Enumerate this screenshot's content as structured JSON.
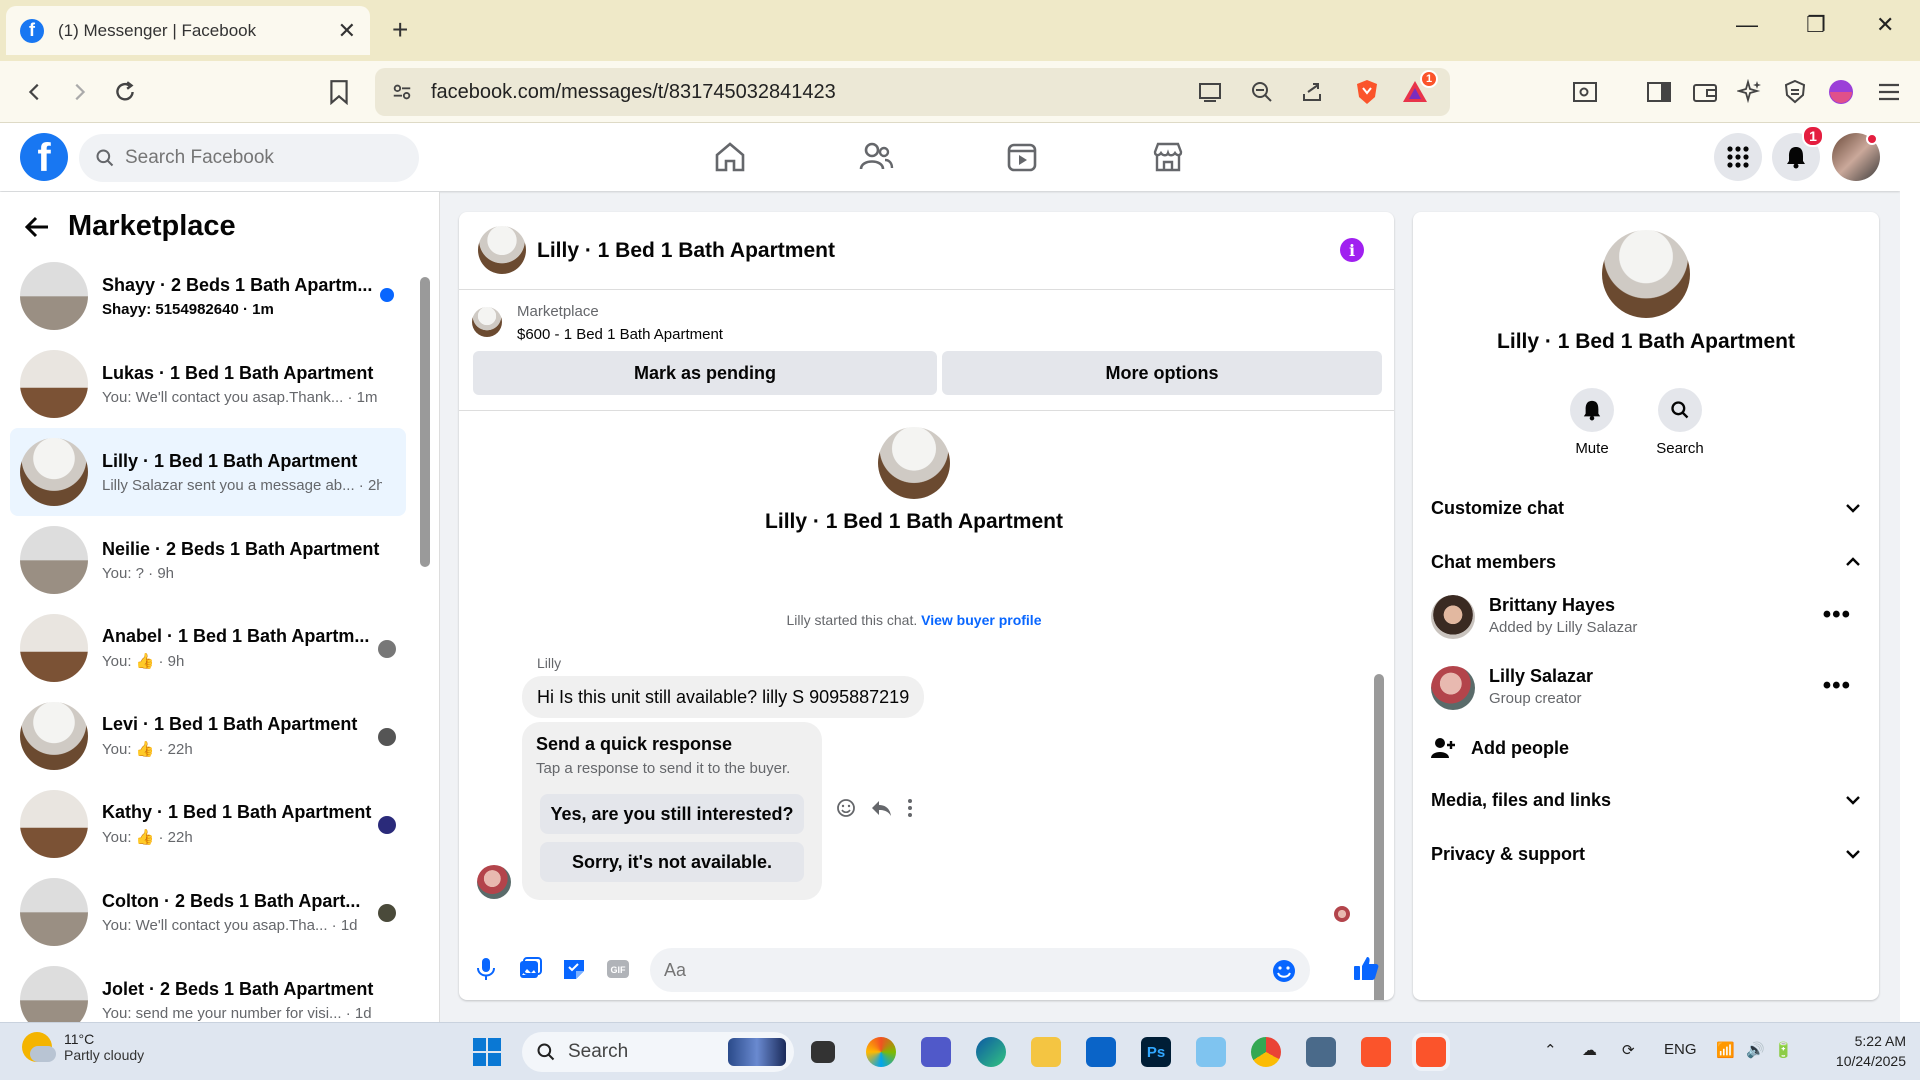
{
  "browser": {
    "tab_title": "(1) Messenger | Facebook",
    "url": "facebook.com/messages/t/831745032841423",
    "extension_badge": "1"
  },
  "fb_header": {
    "search_placeholder": "Search Facebook",
    "notification_count": "1"
  },
  "left_panel": {
    "title": "Marketplace",
    "conversations": [
      {
        "name": "Shayy · 2 Beds 1 Bath Apartm...",
        "snippet": "Shayy: 5154982640 · 1m",
        "unread": true
      },
      {
        "name": "Lukas · 1 Bed 1 Bath Apartment",
        "snippet": "You: We'll contact you asap.Thank... · 1m"
      },
      {
        "name": "Lilly · 1 Bed 1 Bath Apartment",
        "snippet": "Lilly Salazar sent you a message ab... · 2h",
        "active": true
      },
      {
        "name": "Neilie · 2 Beds 1 Bath Apartment",
        "snippet": "You: ? · 9h"
      },
      {
        "name": "Anabel · 1 Bed 1 Bath Apartm...",
        "snippet": "You: 👍 · 9h"
      },
      {
        "name": "Levi · 1 Bed 1 Bath Apartment",
        "snippet": "You: 👍 · 22h"
      },
      {
        "name": "Kathy · 1 Bed 1 Bath Apartment",
        "snippet": "You: 👍 · 22h"
      },
      {
        "name": "Colton · 2 Beds 1 Bath Apart...",
        "snippet": "You: We'll contact you asap.Tha... · 1d"
      },
      {
        "name": "Jolet · 2 Beds 1 Bath Apartment",
        "snippet": "You: send me your number for visi... · 1d"
      }
    ]
  },
  "chat": {
    "title": "Lilly · 1 Bed 1 Bath Apartment",
    "listing_label": "Marketplace",
    "listing_detail": "$600 - 1 Bed 1 Bath Apartment",
    "mark_pending": "Mark as pending",
    "more_options": "More options",
    "big_name": "Lilly · 1 Bed 1 Bath Apartment",
    "started_text": "Lilly started this chat.",
    "view_profile": "View buyer profile",
    "sender": "Lilly",
    "message": "Hi Is this unit still available? lilly S 9095887219",
    "quick_title": "Send a quick response",
    "quick_sub": "Tap a response to send it to the buyer.",
    "quick_yes": "Yes, are you still interested?",
    "quick_no": "Sorry, it's not available.",
    "composer_placeholder": "Aa"
  },
  "right_panel": {
    "name": "Lilly · 1 Bed 1 Bath Apartment",
    "mute": "Mute",
    "search": "Search",
    "customize": "Customize chat",
    "members_header": "Chat members",
    "members": [
      {
        "name": "Brittany Hayes",
        "sub": "Added by Lilly Salazar"
      },
      {
        "name": "Lilly Salazar",
        "sub": "Group creator"
      }
    ],
    "add_people": "Add people",
    "media": "Media, files and links",
    "privacy": "Privacy & support"
  },
  "taskbar": {
    "temp": "11°C",
    "weather": "Partly cloudy",
    "search": "Search",
    "lang": "ENG",
    "time": "5:22 AM",
    "date": "10/24/2025"
  },
  "colors": {
    "fb_blue": "#1877f2",
    "messenger_blue": "#0866ff",
    "info_purple": "#a020f0",
    "badge_red": "#e41e3f"
  }
}
